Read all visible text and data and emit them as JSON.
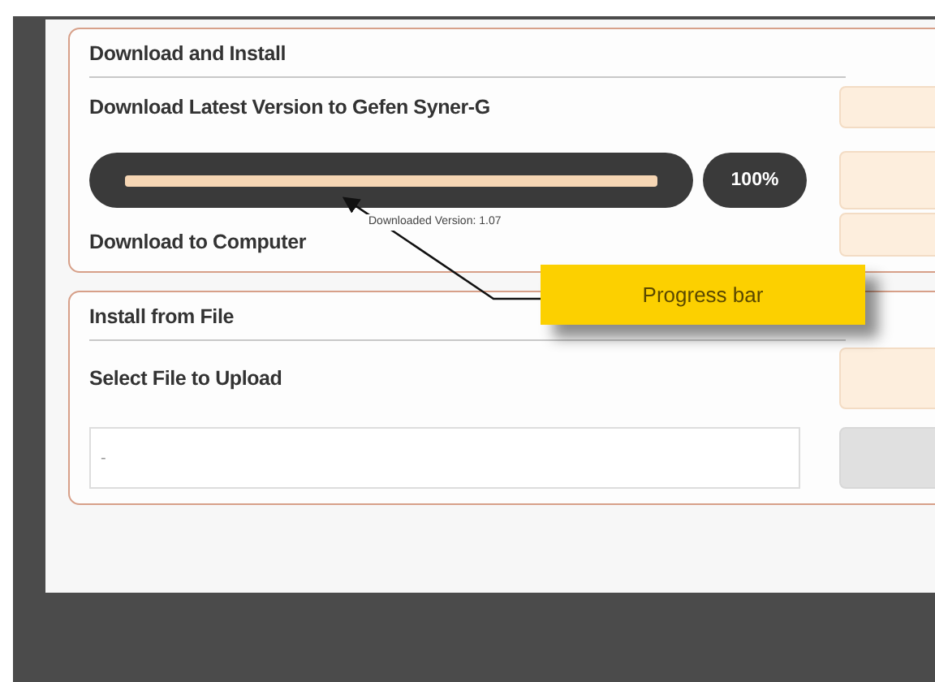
{
  "download_section": {
    "title": "Download and Install",
    "latest_label": "Download Latest Version to Gefen Syner-G",
    "progress": {
      "level": 1,
      "reading": "100%"
    },
    "version_note": "Downloaded Version: 1.07",
    "computer_label": "Download to Computer",
    "buttons": [
      {
        "disabled": false
      },
      {
        "disabled": false
      },
      {
        "disabled": false
      }
    ]
  },
  "install_section": {
    "title": "Install from File",
    "select_label": "Select File to Upload",
    "file_field": {
      "value": "-"
    },
    "buttons": [
      {
        "disabled": false
      },
      {
        "disabled": true
      }
    ]
  },
  "callout": {
    "text": "Progress bar"
  }
}
